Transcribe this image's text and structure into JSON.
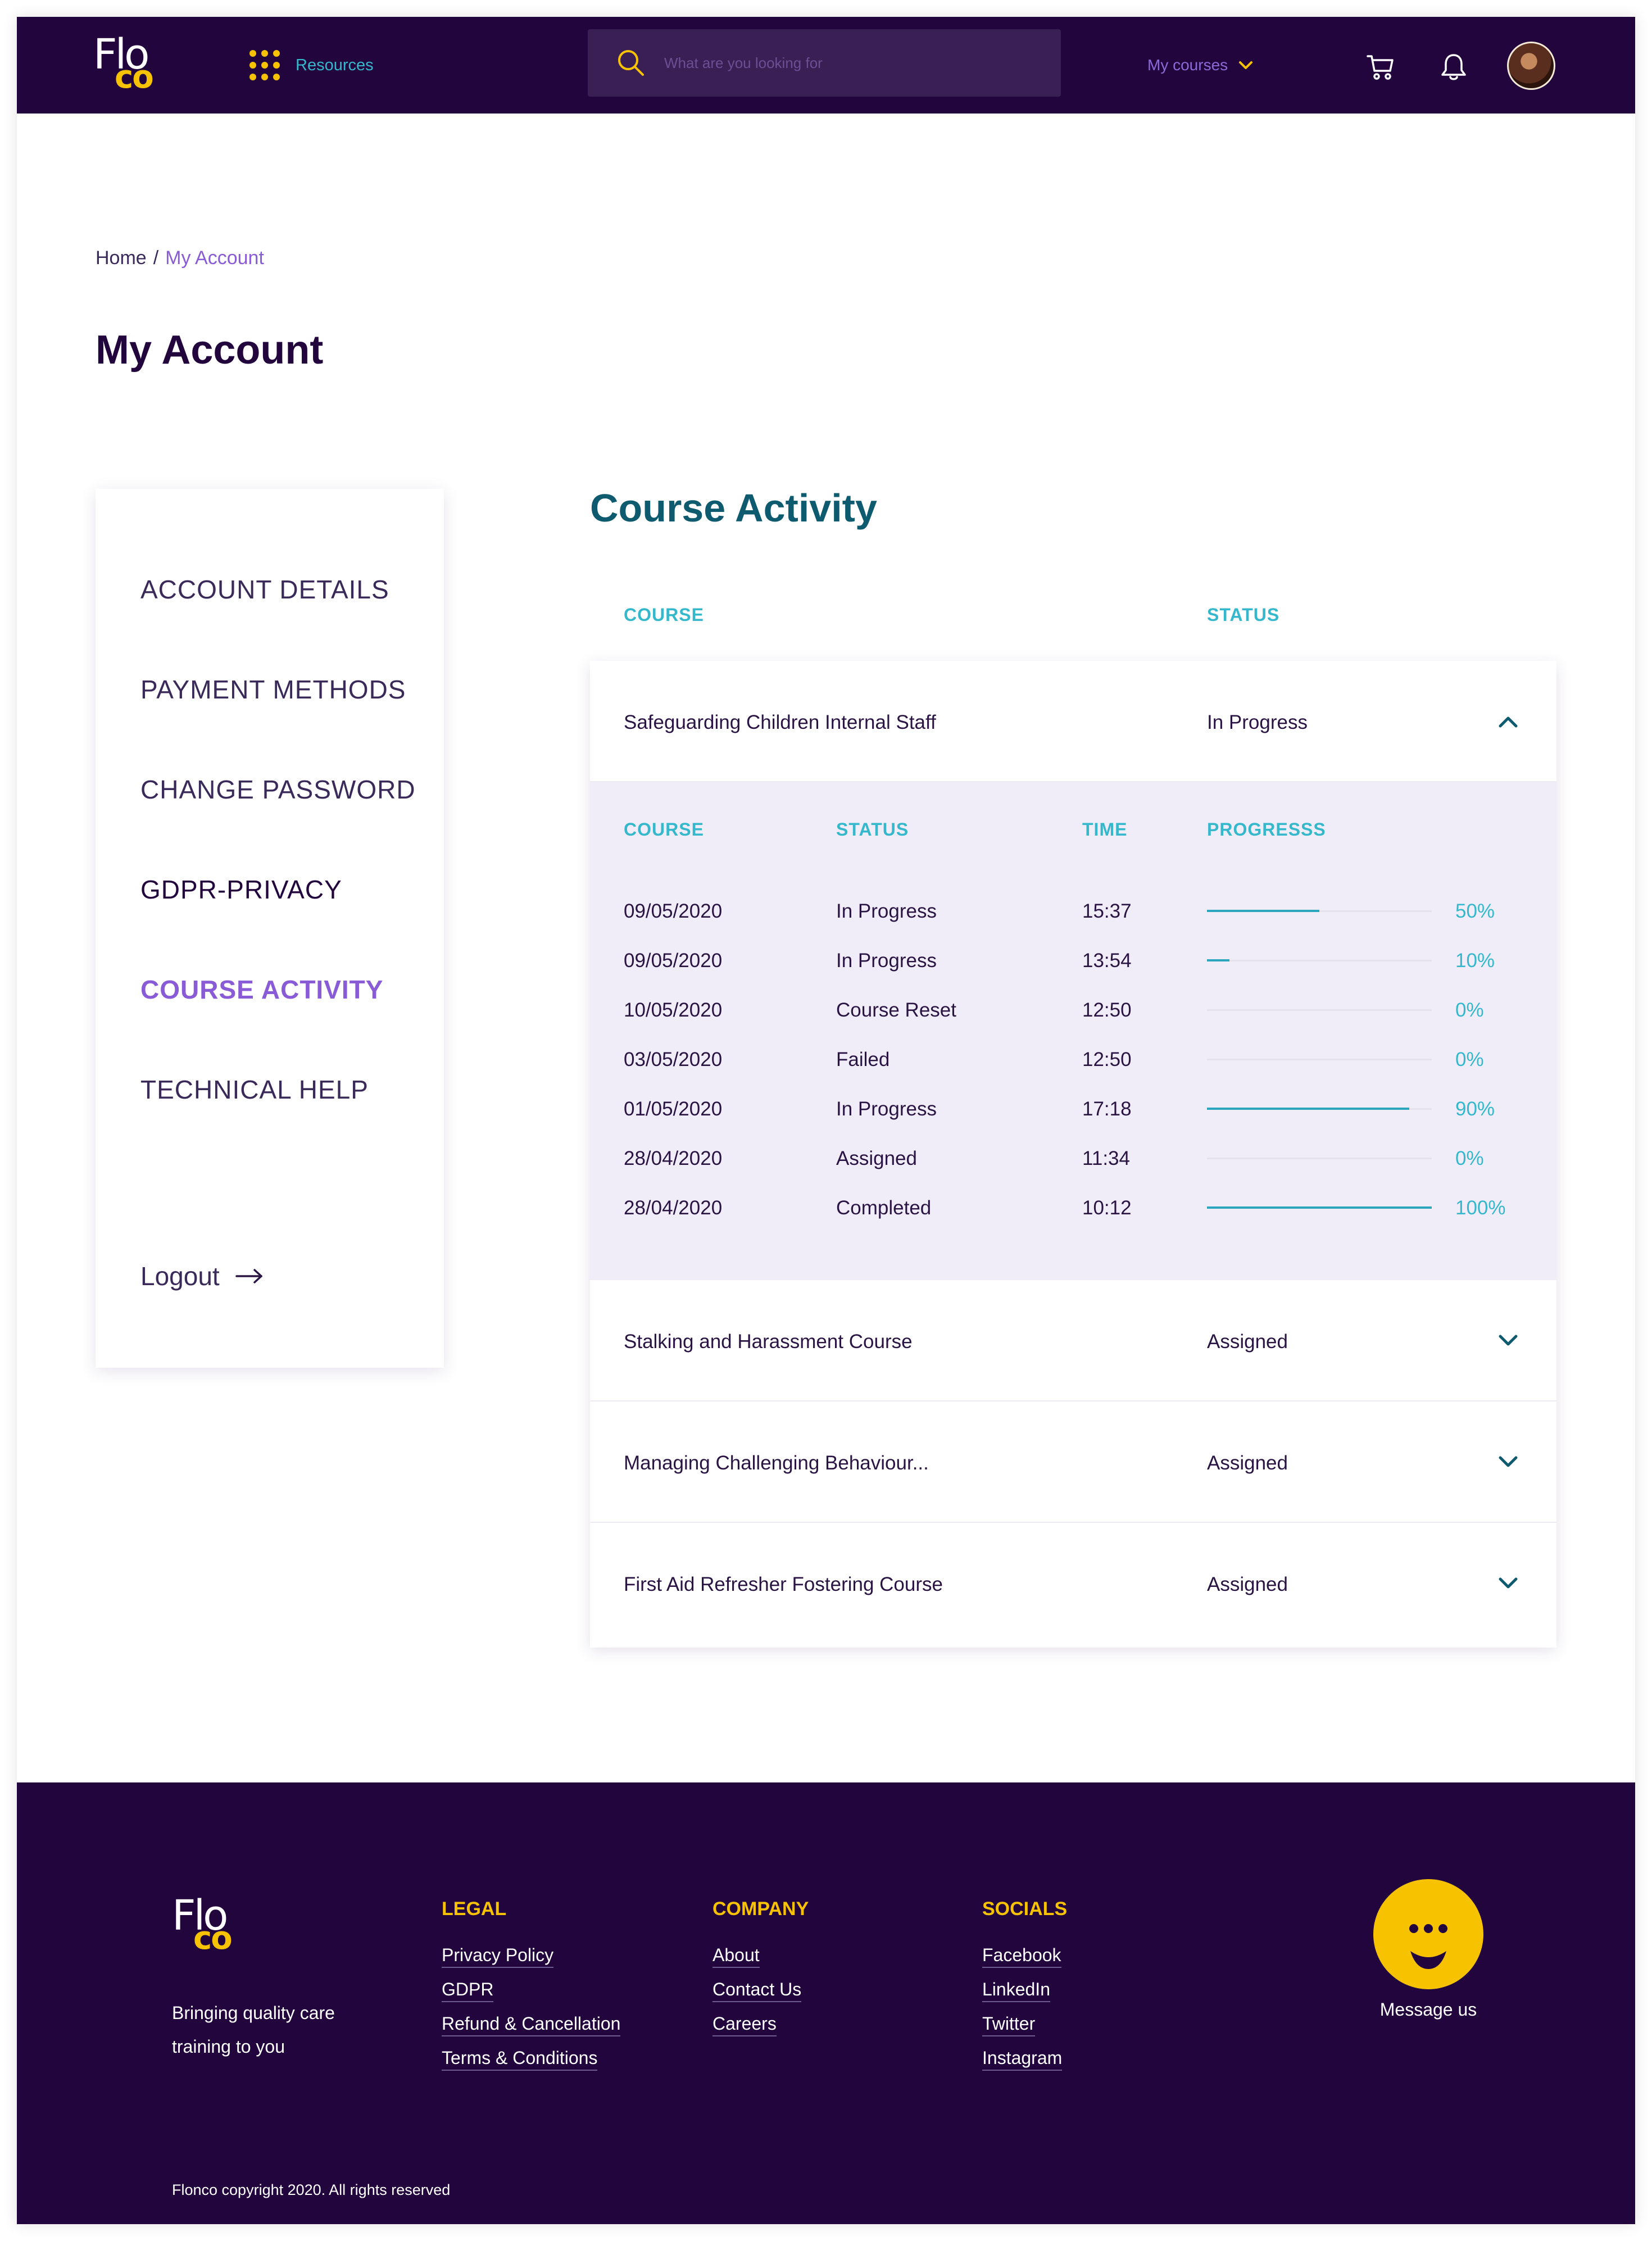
{
  "brand": {
    "logo_top": "Flo",
    "logo_bottom": "co",
    "accent": "#f7c300",
    "header_bg": "#23053d"
  },
  "header": {
    "resources_label": "Resources",
    "search_placeholder": "What are you looking for",
    "my_courses_label": "My courses"
  },
  "breadcrumb": {
    "home": "Home",
    "separator": "/",
    "current": "My Account"
  },
  "page_title": "My Account",
  "sidebar": {
    "items": [
      {
        "label": "ACCOUNT DETAILS"
      },
      {
        "label": "PAYMENT METHODS"
      },
      {
        "label": "CHANGE PASSWORD"
      },
      {
        "label": "GDPR-PRIVACY"
      },
      {
        "label": "COURSE ACTIVITY",
        "active": true
      },
      {
        "label": "TECHNICAL HELP"
      }
    ],
    "logout_label": "Logout"
  },
  "main": {
    "title": "Course Activity",
    "columns": {
      "course": "COURSE",
      "status": "STATUS"
    },
    "courses": [
      {
        "name": "Safeguarding Children Internal Staff",
        "status": "In Progress",
        "expanded": true
      },
      {
        "name": "Stalking and Harassment Course",
        "status": "Assigned",
        "expanded": false
      },
      {
        "name": "Managing Challenging Behaviour...",
        "status": "Assigned",
        "expanded": false
      },
      {
        "name": "First Aid Refresher Fostering Course",
        "status": "Assigned",
        "expanded": false
      }
    ],
    "detail": {
      "columns": {
        "course": "COURSE",
        "status": "STATUS",
        "time": "TIME",
        "progress": "PROGRESSS"
      },
      "rows": [
        {
          "date": "09/05/2020",
          "status": "In Progress",
          "time": "15:37",
          "progress": 50,
          "progress_label": "50%"
        },
        {
          "date": "09/05/2020",
          "status": "In Progress",
          "time": "13:54",
          "progress": 10,
          "progress_label": "10%"
        },
        {
          "date": "10/05/2020",
          "status": "Course Reset",
          "time": "12:50",
          "progress": 0,
          "progress_label": "0%"
        },
        {
          "date": "03/05/2020",
          "status": "Failed",
          "time": "12:50",
          "progress": 0,
          "progress_label": "0%"
        },
        {
          "date": "01/05/2020",
          "status": "In Progress",
          "time": "17:18",
          "progress": 90,
          "progress_label": "90%"
        },
        {
          "date": "28/04/2020",
          "status": "Assigned",
          "time": "11:34",
          "progress": 0,
          "progress_label": "0%"
        },
        {
          "date": "28/04/2020",
          "status": "Completed",
          "time": "10:12",
          "progress": 100,
          "progress_label": "100%"
        }
      ]
    }
  },
  "footer": {
    "tagline": "Bringing quality care training to you",
    "legal": {
      "heading": "LEGAL",
      "links": [
        "Privacy Policy",
        "GDPR",
        "Refund & Cancellation",
        "Terms & Conditions"
      ]
    },
    "company": {
      "heading": "COMPANY",
      "links": [
        "About",
        "Contact Us",
        "Careers"
      ]
    },
    "socials": {
      "heading": "SOCIALS",
      "links": [
        "Facebook",
        "LinkedIn",
        "Twitter",
        "Instagram"
      ]
    },
    "message_label": "Message us",
    "copyright": "Flonco copyright 2020. All rights reserved"
  }
}
